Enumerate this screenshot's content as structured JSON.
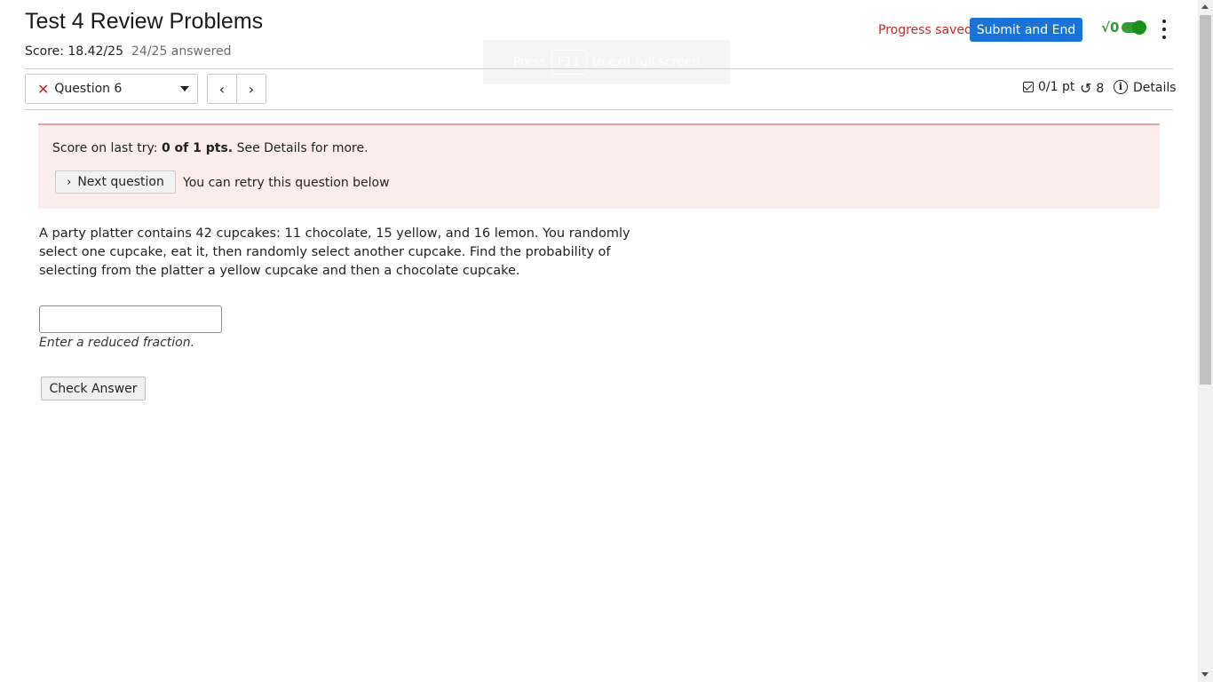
{
  "header": {
    "title": "Test 4 Review Problems",
    "score": "Score: 18.42/25",
    "answered": "24/25 answered",
    "progress_status": "Progress saved",
    "submit_label": "Submit and End",
    "math_toggle_label": "√0"
  },
  "toast": {
    "prefix": "Press",
    "key": "F11",
    "suffix": "to exit full screen"
  },
  "nav": {
    "question_label": "Question 6",
    "question_status": "✕",
    "prev_glyph": "‹",
    "next_glyph": "›"
  },
  "meta": {
    "points": "0/1 pt",
    "retries": "8",
    "details_label": "Details"
  },
  "alert": {
    "prefix": "Score on last try: ",
    "score_bold": "0 of 1 pts.",
    "suffix": " See Details for more.",
    "next_button": "Next question",
    "retry_text": "You can retry this question below"
  },
  "question": {
    "text": "A party platter contains 42 cupcakes: 11 chocolate, 15 yellow, and 16 lemon. You randomly select one cupcake, eat it, then randomly select another cupcake. Find the probability of selecting from the platter a yellow cupcake and then a chocolate cupcake.",
    "answer_value": "",
    "hint": "Enter a reduced fraction.",
    "check_button": "Check Answer"
  },
  "colors": {
    "accent": "#1a73d9",
    "error": "#c62828",
    "alert_bg": "#fdeeee",
    "toggle_on": "#2e9e2e"
  }
}
